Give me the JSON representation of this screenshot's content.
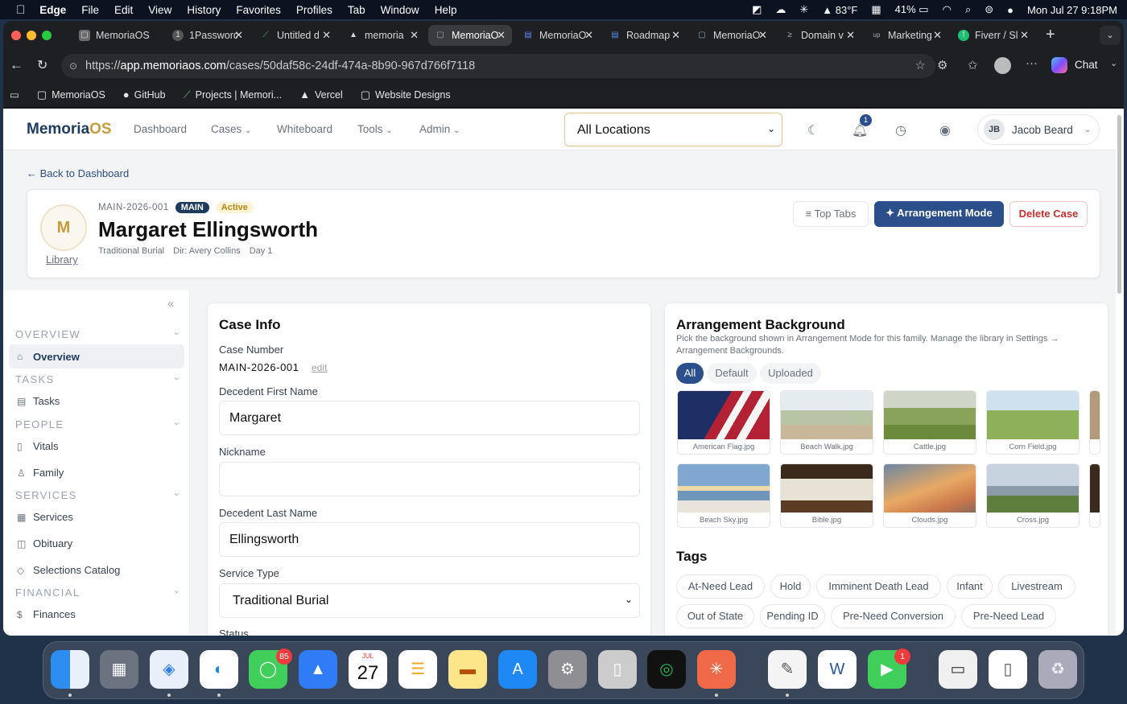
{
  "menubar": {
    "app": "Edge",
    "items": [
      "File",
      "Edit",
      "View",
      "History",
      "Favorites",
      "Profiles",
      "Tab",
      "Window",
      "Help"
    ],
    "weather": "83°F",
    "battery": "41%",
    "datetime": "Mon Jul 27  9:18PM"
  },
  "tabs": [
    {
      "label": "MemoriaOS",
      "icon": "memoria-icon"
    },
    {
      "label": "1Password",
      "icon": "1password-icon"
    },
    {
      "label": "Untitled d",
      "icon": "untitled-icon"
    },
    {
      "label": "memoria",
      "icon": "vercel-icon"
    },
    {
      "label": "MemoriaO",
      "icon": "memoria-icon"
    },
    {
      "label": "MemoriaO",
      "icon": "doc-icon"
    },
    {
      "label": "Roadmap",
      "icon": "doc-icon"
    },
    {
      "label": "MemoriaO",
      "icon": "memoria-icon"
    },
    {
      "label": "Domain v",
      "icon": "domain-icon"
    },
    {
      "label": "Marketing",
      "icon": "marketing-icon"
    },
    {
      "label": "Fiverr / Sl",
      "icon": "fiverr-icon"
    }
  ],
  "address": {
    "prefix": "https://",
    "host": "app.memoriaos.com",
    "path": "/cases/50daf58c-24df-474a-8b90-967d766f7118",
    "chat_label": "Chat"
  },
  "bookmarks": [
    {
      "label": "MemoriaOS",
      "icon": "folder-icon"
    },
    {
      "label": "GitHub",
      "icon": "github-icon"
    },
    {
      "label": "Projects | Memori...",
      "icon": "projects-icon"
    },
    {
      "label": "Vercel",
      "icon": "vercel-icon"
    },
    {
      "label": "Website Designs",
      "icon": "folder-icon"
    }
  ],
  "app": {
    "logo_a": "Memoria",
    "logo_b": "OS",
    "nav": [
      "Dashboard",
      "Cases",
      "Whiteboard",
      "Tools",
      "Admin"
    ],
    "location": "All Locations",
    "notif_count": "1",
    "user_initials": "JB",
    "user_name": "Jacob Beard"
  },
  "back_label": "← Back to Dashboard",
  "case": {
    "avatar_letter": "M",
    "library_link": "Library",
    "number": "MAIN-2026-001",
    "badge_main": "MAIN",
    "badge_status": "Active",
    "name": "Margaret Ellingsworth",
    "service": "Traditional Burial",
    "director": "Dir: Avery Collins",
    "day": "Day 1",
    "btn_top_tabs": "≡ Top Tabs",
    "btn_arrangement": "✦ Arrangement Mode",
    "btn_delete": "Delete Case"
  },
  "sidebar": {
    "sections": [
      "OVERVIEW",
      "TASKS",
      "PEOPLE",
      "SERVICES",
      "FINANCIAL"
    ],
    "items": [
      "Overview",
      "Tasks",
      "Vitals",
      "Family",
      "Services",
      "Obituary",
      "Selections Catalog",
      "Finances"
    ]
  },
  "caseinfo": {
    "title": "Case Info",
    "case_number_label": "Case Number",
    "case_number_value": "MAIN-2026-001",
    "edit_link": "edit",
    "first_name_label": "Decedent First Name",
    "first_name": "Margaret",
    "nickname_label": "Nickname",
    "nickname": "",
    "last_name_label": "Decedent Last Name",
    "last_name": "Ellingsworth",
    "service_type_label": "Service Type",
    "service_type": "Traditional Burial",
    "status_label": "Status"
  },
  "background": {
    "title": "Arrangement Background",
    "description": "Pick the background shown in Arrangement Mode for this family. Manage the library in Settings → Arrangement Backgrounds.",
    "filters": [
      "All",
      "Default",
      "Uploaded"
    ],
    "images": [
      "American Flag.jpg",
      "Beach Walk.jpg",
      "Cattle.jpg",
      "Corn Field.jpg",
      "Beach Sky.jpg",
      "Bible.jpg",
      "Clouds.jpg",
      "Cross.jpg"
    ]
  },
  "tags": {
    "title": "Tags",
    "items": [
      "At-Need Lead",
      "Hold",
      "Imminent Death Lead",
      "Infant",
      "Livestream",
      "Out of State",
      "Pending ID",
      "Pre-Need Conversion",
      "Pre-Need Lead"
    ]
  },
  "dock": {
    "messages_badge": "85",
    "calendar_month": "JUL",
    "calendar_day": "27",
    "facetime_badge": "1"
  }
}
